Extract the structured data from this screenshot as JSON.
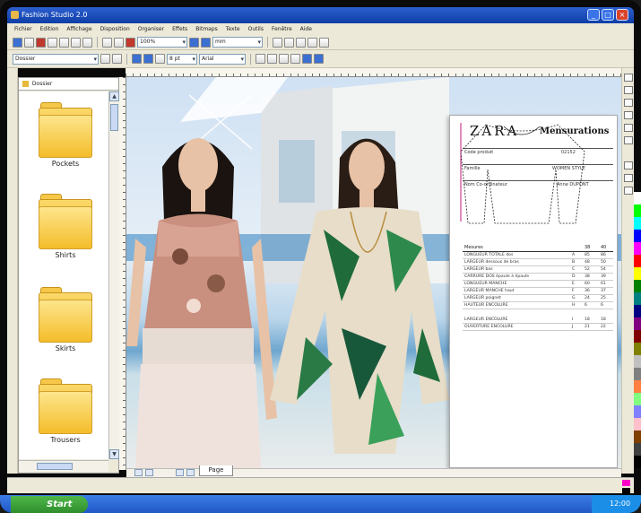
{
  "window": {
    "title": "Fashion Studio 2.0"
  },
  "menu": {
    "items": [
      "Fichier",
      "Edition",
      "Affichage",
      "Disposition",
      "Organiser",
      "Effets",
      "Bitmaps",
      "Texte",
      "Outils",
      "Fenêtre",
      "Aide"
    ]
  },
  "toolbar": {
    "zoom_value": "100%",
    "size_value": "8 pt",
    "font_value": "Arial",
    "units_value": "mm"
  },
  "sidebar": {
    "path_value": "Dossier",
    "folders": [
      {
        "label": "Pockets",
        "icon": "folder-icon"
      },
      {
        "label": "Shirts",
        "icon": "folder-icon"
      },
      {
        "label": "Skirts",
        "icon": "folder-icon"
      },
      {
        "label": "Trousers",
        "icon": "folder-icon"
      }
    ]
  },
  "canvas": {
    "page_tab": "Page"
  },
  "spec_sheet": {
    "brand": "ZARA",
    "title": "Mensurations",
    "meta": [
      {
        "k": "Code produit",
        "v": "02152"
      },
      {
        "k": "Famille",
        "v": "WOMEN STYLE"
      },
      {
        "k": "Nom Co-ordinateur",
        "v": "Anne DUPONT"
      }
    ],
    "table_header": {
      "label": "Mesures",
      "col1": "38",
      "col2": "40"
    },
    "rows": [
      {
        "label": "LONGUEUR TOTALE dos",
        "code": "A",
        "v1": "85",
        "v2": "86"
      },
      {
        "label": "LARGEUR dessous de bras",
        "code": "B",
        "v1": "48",
        "v2": "50"
      },
      {
        "label": "LARGEUR bas",
        "code": "C",
        "v1": "52",
        "v2": "54"
      },
      {
        "label": "CARRURE DOS épaule à épaule",
        "code": "D",
        "v1": "38",
        "v2": "39"
      },
      {
        "label": "LONGUEUR MANCHE",
        "code": "E",
        "v1": "60",
        "v2": "61"
      },
      {
        "label": "LARGEUR MANCHE haut",
        "code": "F",
        "v1": "36",
        "v2": "37"
      },
      {
        "label": "LARGEUR poignet",
        "code": "G",
        "v1": "24",
        "v2": "25"
      },
      {
        "label": "HAUTEUR ENCOLURE",
        "code": "H",
        "v1": "6",
        "v2": "6"
      },
      {
        "label": "LARGEUR ENCOLURE",
        "code": "I",
        "v1": "18",
        "v2": "18"
      },
      {
        "label": "OUVERTURE ENCOLURE",
        "code": "J",
        "v1": "21",
        "v2": "22"
      }
    ]
  },
  "taskbar": {
    "start_label": "Start",
    "clock": "12:00"
  },
  "colors": {
    "accent": "#245edb",
    "folder": "#f4bd2a",
    "magenta": "#ff00c8"
  }
}
